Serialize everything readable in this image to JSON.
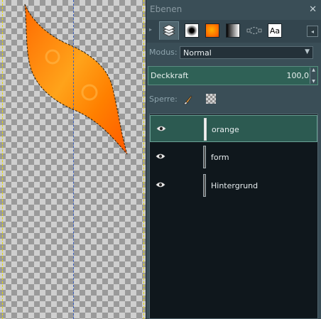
{
  "dock": {
    "title": "Ebenen",
    "close_glyph": "✕"
  },
  "tabs": {
    "items": [
      {
        "name": "layers-tab",
        "icon": "layers-icon"
      },
      {
        "name": "brushes-tab",
        "icon": "brush-icon"
      },
      {
        "name": "patterns-tab",
        "icon": "pattern-icon"
      },
      {
        "name": "gradients-tab",
        "icon": "gradient-icon"
      },
      {
        "name": "paths-tab",
        "icon": "paths-icon"
      },
      {
        "name": "fonts-tab",
        "icon": "fonts-icon",
        "label": "Aa"
      }
    ],
    "menu_glyph": "◂"
  },
  "mode": {
    "label": "Modus:",
    "value": "Normal"
  },
  "opacity": {
    "label": "Deckkraft",
    "value": "100,0"
  },
  "lock": {
    "label": "Sperre:"
  },
  "layers": [
    {
      "name": "orange",
      "visible": true,
      "selected": true
    },
    {
      "name": "form",
      "visible": true,
      "selected": false
    },
    {
      "name": "Hintergrund",
      "visible": true,
      "selected": false
    }
  ],
  "colors": {
    "selected_row": "#2c5a51",
    "shape_orange": "#ff8c00",
    "guide": "#3a5fbf"
  }
}
